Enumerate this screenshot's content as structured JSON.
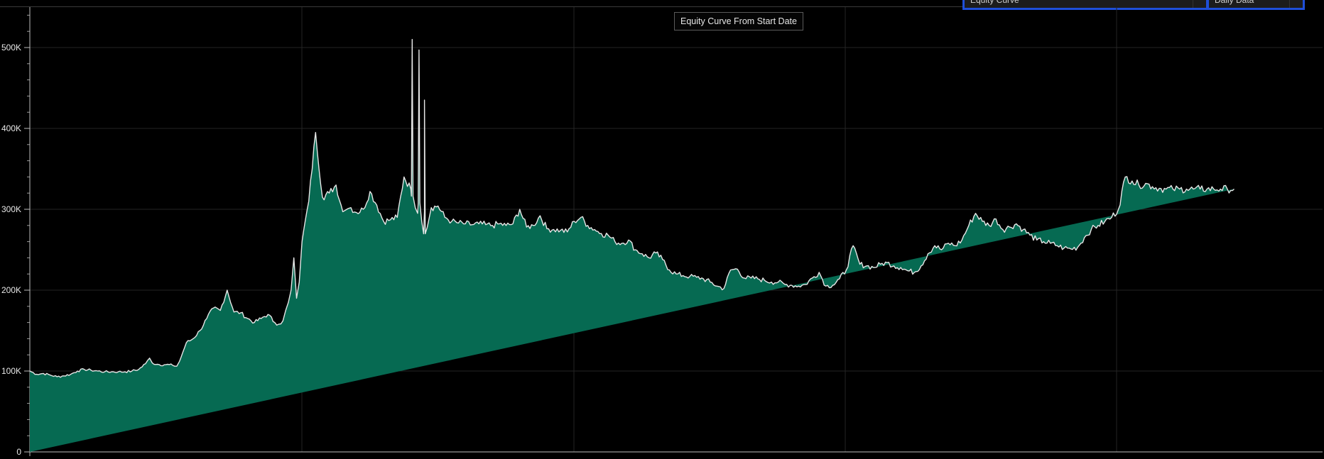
{
  "title": "Equity Curve From Start Date",
  "selectors": {
    "curve_type": "Equity Curve",
    "data_type": "Daily Data"
  },
  "colors": {
    "background": "#000000",
    "fill": "#066a52",
    "line": "#e6e6e6",
    "grid": "#242424",
    "selector_border": "#1f4fd8"
  },
  "chart_data": {
    "type": "area",
    "title": "Equity Curve From Start Date",
    "xlabel": "",
    "ylabel": "",
    "ylim": [
      0,
      550000
    ],
    "yticks": [
      0,
      100000,
      200000,
      300000,
      400000,
      500000
    ],
    "ytick_labels": [
      "0",
      "100K",
      "200K",
      "300K",
      "400K",
      "500K"
    ],
    "grid": true,
    "x": [
      0,
      5,
      10,
      15,
      20,
      25,
      30,
      35,
      40,
      45,
      50,
      55,
      60,
      65,
      70,
      75,
      80,
      85,
      88,
      90,
      95,
      100,
      105,
      108,
      110,
      115,
      120,
      125,
      130,
      135,
      140,
      145,
      150,
      155,
      160,
      165,
      170,
      175,
      180,
      183,
      186,
      188,
      190,
      192,
      194,
      196,
      198,
      200,
      205,
      210,
      215,
      220,
      225,
      230,
      232,
      234,
      236,
      240,
      245,
      250,
      255,
      260,
      265,
      270,
      275,
      280,
      285,
      290,
      295,
      300,
      305,
      310,
      315,
      320,
      325,
      330,
      335,
      340,
      345,
      350,
      355,
      360,
      365,
      370,
      375,
      380,
      385,
      390,
      395,
      400,
      405,
      410,
      415,
      420,
      425,
      430,
      435,
      440,
      445,
      450,
      455,
      460,
      465,
      470,
      475,
      480,
      485,
      490,
      495,
      500,
      505,
      510,
      515,
      520,
      525,
      530,
      535,
      540,
      545,
      550,
      555,
      560,
      565,
      570,
      575,
      580,
      585,
      590,
      595,
      600,
      605,
      610,
      615,
      620,
      625,
      630,
      635,
      640,
      645,
      650,
      655,
      660,
      665,
      670,
      675,
      680,
      685,
      690,
      695,
      700,
      705,
      710,
      715,
      720,
      725,
      730,
      735,
      740,
      745,
      750,
      755,
      760,
      765,
      770,
      775,
      780,
      785,
      790,
      795,
      800,
      805,
      810,
      815,
      820,
      825,
      830,
      835,
      840,
      845,
      850,
      855,
      860,
      865,
      870,
      875,
      880,
      885,
      890,
      895,
      900,
      905,
      910,
      915,
      920,
      925,
      930,
      935,
      940,
      945,
      950
    ],
    "values": [
      100000,
      96000,
      97000,
      95000,
      93000,
      94000,
      96000,
      100000,
      102000,
      101000,
      100000,
      99000,
      99000,
      99000,
      99000,
      100000,
      102000,
      109000,
      116000,
      110000,
      108000,
      108000,
      107000,
      106000,
      112000,
      135000,
      140000,
      150000,
      165000,
      178000,
      175000,
      200000,
      173000,
      172000,
      165000,
      160000,
      165000,
      170000,
      160000,
      158000,
      162000,
      175000,
      185000,
      200000,
      240000,
      190000,
      210000,
      260000,
      310000,
      395000,
      315000,
      320000,
      330000,
      297000,
      299000,
      301000,
      302000,
      296000,
      300000,
      322000,
      305000,
      285000,
      287000,
      290000,
      340000,
      325000,
      295000,
      298000,
      302000,
      304000,
      290000,
      285000,
      283000,
      282000,
      281000,
      282000,
      281000,
      280000,
      282000,
      280000,
      282000,
      300000,
      278000,
      280000,
      292000,
      276000,
      275000,
      274000,
      272000,
      285000,
      290000,
      280000,
      275000,
      270000,
      268000,
      260000,
      258000,
      262000,
      250000,
      245000,
      240000,
      246000,
      238000,
      225000,
      220000,
      218000,
      217000,
      216000,
      214000,
      210000,
      205000,
      202000,
      225000,
      226000,
      215000,
      215000,
      214000,
      212000,
      210000,
      210000,
      207000,
      206000,
      205000,
      207000,
      215000,
      222000,
      205000,
      206000,
      214000,
      225000,
      255000,
      232000,
      230000,
      228000,
      232000,
      234000,
      230000,
      228000,
      224000,
      222000,
      230000,
      245000,
      255000,
      250000,
      258000,
      255000,
      262000,
      280000,
      295000,
      285000,
      280000,
      288000,
      275000,
      278000,
      282000,
      275000,
      268000,
      262000,
      260000,
      258000,
      255000,
      252000,
      251000,
      253000,
      265000,
      275000,
      280000,
      285000,
      290000,
      300000,
      340000,
      335000,
      330000,
      332000,
      328000,
      326000,
      325000,
      325000,
      325000,
      325000,
      325000,
      325000,
      325000,
      325000,
      325000,
      325000,
      325000
    ],
    "x_domain": [
      0,
      950
    ],
    "spikes": [
      {
        "x": 281,
        "y": 510000
      },
      {
        "x": 286,
        "y": 497000
      },
      {
        "x": 290,
        "y": 435000
      }
    ],
    "series": [
      {
        "values_ref": "values"
      }
    ]
  }
}
